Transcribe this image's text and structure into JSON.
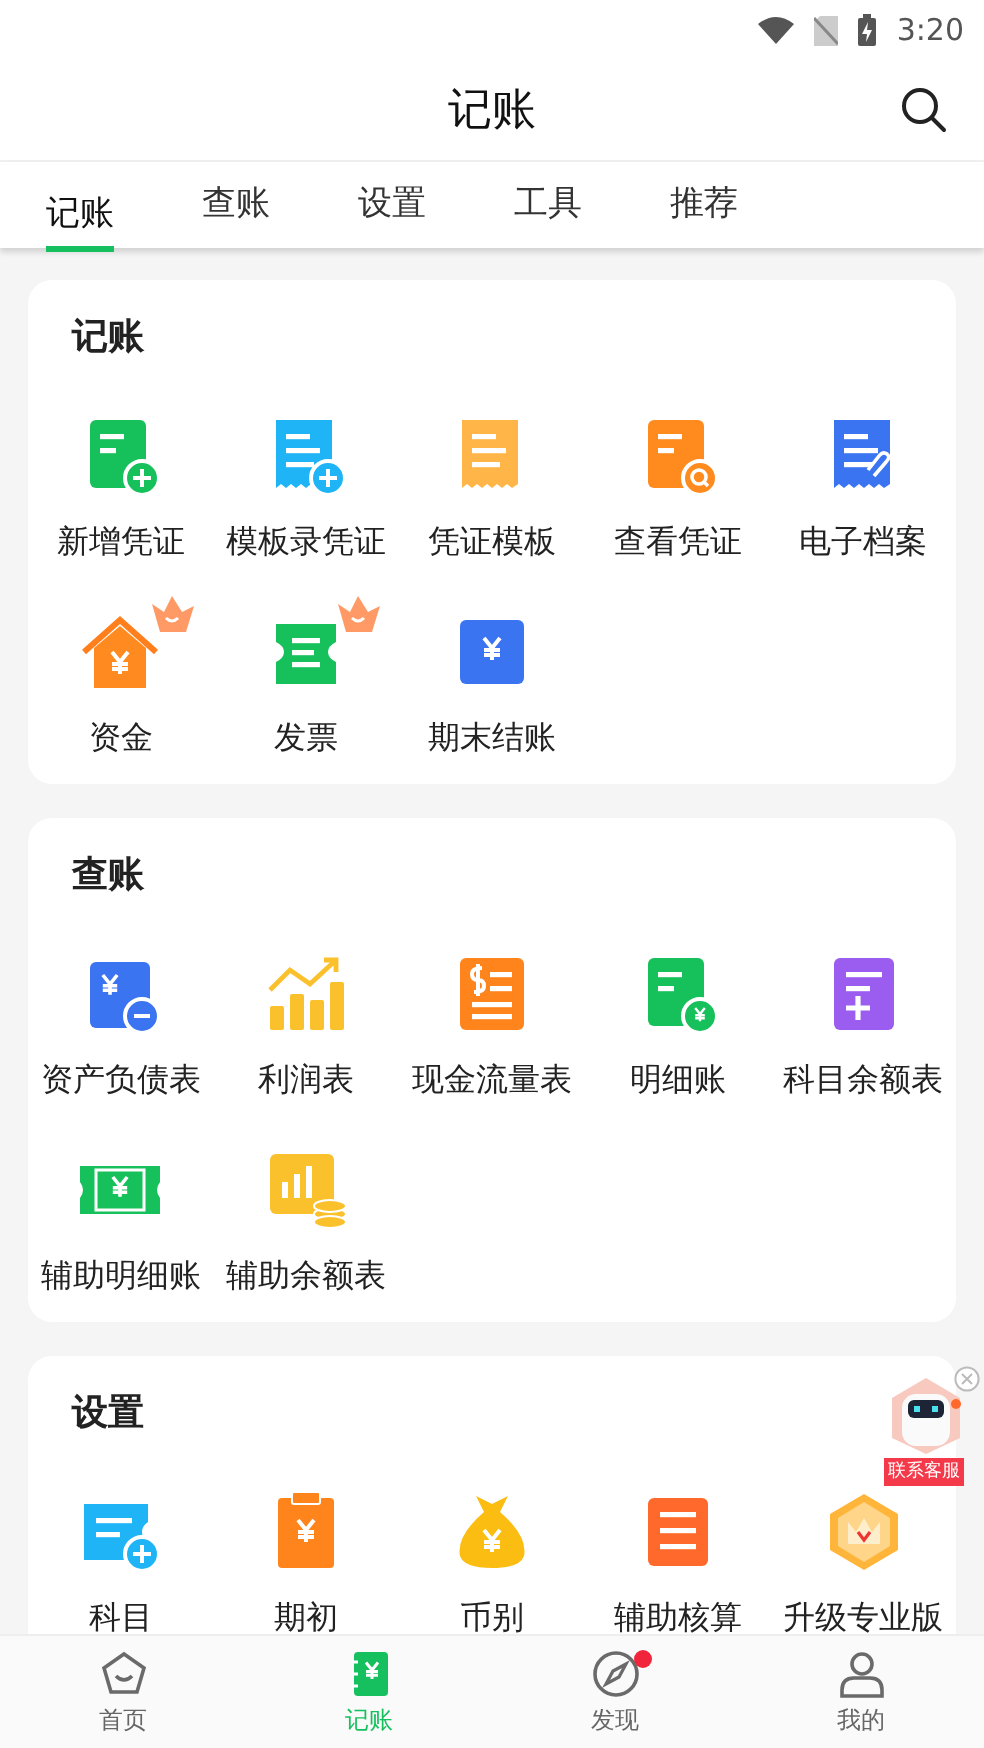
{
  "status_bar": {
    "time": "3:20"
  },
  "header": {
    "title": "记账"
  },
  "tabs": [
    {
      "label": "记账",
      "selected": true
    },
    {
      "label": "查账",
      "selected": false
    },
    {
      "label": "设置",
      "selected": false
    },
    {
      "label": "工具",
      "selected": false
    },
    {
      "label": "推荐",
      "selected": false
    }
  ],
  "sections": [
    {
      "title": "记账",
      "items": [
        {
          "label": "新增凭证",
          "premium": false
        },
        {
          "label": "模板录凭证",
          "premium": false
        },
        {
          "label": "凭证模板",
          "premium": false
        },
        {
          "label": "查看凭证",
          "premium": false
        },
        {
          "label": "电子档案",
          "premium": false
        },
        {
          "label": "资金",
          "premium": true
        },
        {
          "label": "发票",
          "premium": true
        },
        {
          "label": "期末结账",
          "premium": false
        }
      ]
    },
    {
      "title": "查账",
      "items": [
        {
          "label": "资产负债表",
          "premium": false
        },
        {
          "label": "利润表",
          "premium": false
        },
        {
          "label": "现金流量表",
          "premium": false
        },
        {
          "label": "明细账",
          "premium": false
        },
        {
          "label": "科目余额表",
          "premium": false
        },
        {
          "label": "辅助明细账",
          "premium": false
        },
        {
          "label": "辅助余额表",
          "premium": false
        }
      ]
    },
    {
      "title": "设置",
      "items": [
        {
          "label": "科目",
          "premium": false
        },
        {
          "label": "期初",
          "premium": false
        },
        {
          "label": "币别",
          "premium": false
        },
        {
          "label": "辅助核算",
          "premium": false
        },
        {
          "label": "升级专业版",
          "premium": false
        }
      ]
    }
  ],
  "support_widget": {
    "label": "联系客服"
  },
  "bottom_nav": [
    {
      "label": "首页",
      "selected": false,
      "badge": false
    },
    {
      "label": "记账",
      "selected": true,
      "badge": false
    },
    {
      "label": "发现",
      "selected": false,
      "badge": true
    },
    {
      "label": "我的",
      "selected": false,
      "badge": false
    }
  ]
}
